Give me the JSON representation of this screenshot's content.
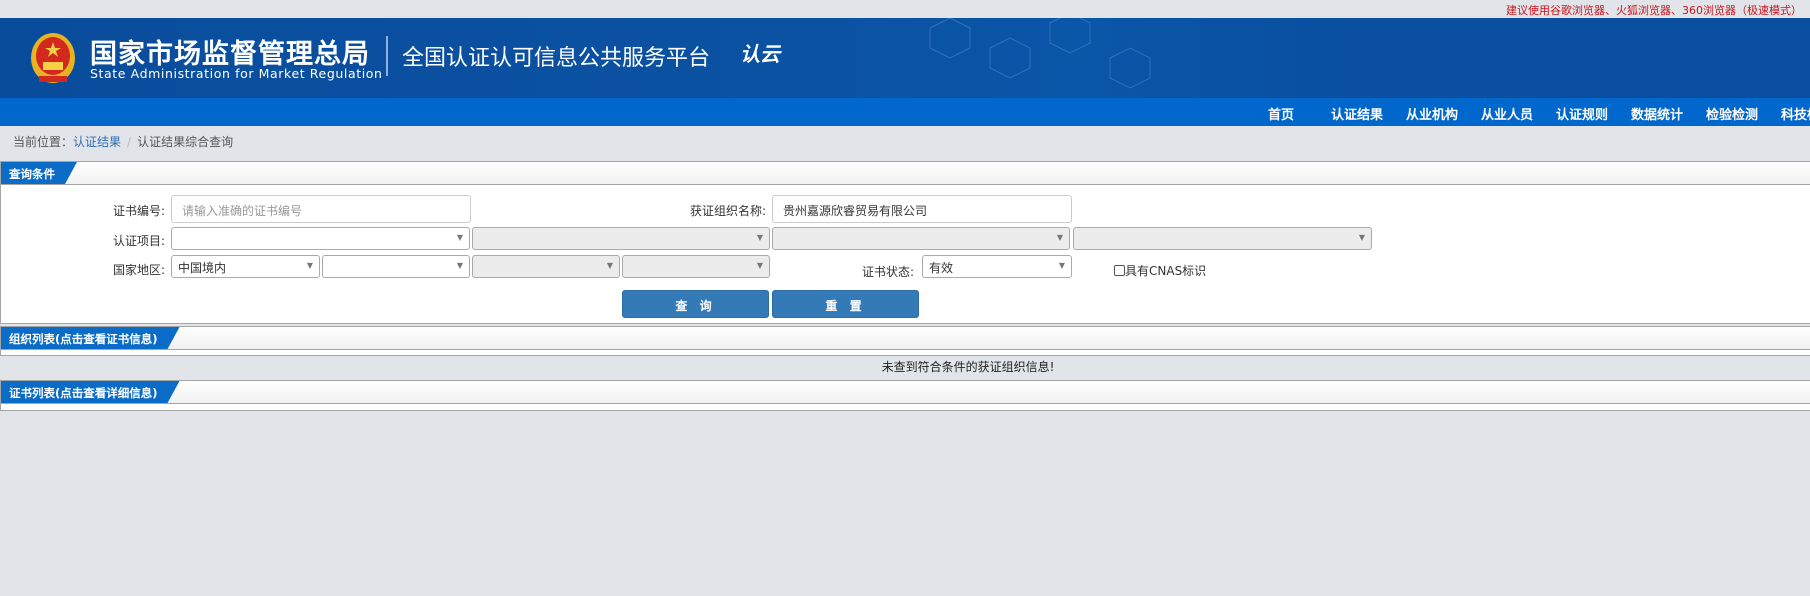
{
  "top_tip": "建议使用谷歌浏览器、火狐浏览器、360浏览器（极速模式）",
  "header": {
    "org_cn": "国家市场监督管理总局",
    "org_en": "State Administration  for  Market Regulation",
    "platform": "全国认证认可信息公共服务平台",
    "logo_text": "认云"
  },
  "nav": [
    "首页",
    "认证结果",
    "从业机构",
    "从业人员",
    "认证规则",
    "数据统计",
    "检验检测",
    "科技标"
  ],
  "breadcrumb": {
    "prefix": "当前位置：",
    "link": "认证结果",
    "current": "认证结果综合查询"
  },
  "query_panel": {
    "title": "查询条件",
    "cert_no_label": "证书编号:",
    "cert_no_placeholder": "请输入准确的证书编号",
    "org_name_label": "获证组织名称:",
    "org_name_value": "贵州嘉源欣睿贸易有限公司",
    "project_label": "认证项目:",
    "region_label": "国家地区:",
    "region_value": "中国境内",
    "status_label": "证书状态:",
    "status_value": "有效",
    "cnas_label": "具有CNAS标识",
    "query_button": "查 询",
    "reset_button": "重 置"
  },
  "org_list": {
    "title": "组织列表(点击查看证书信息)",
    "empty_message": "未查到符合条件的获证组织信息!"
  },
  "cert_list": {
    "title": "证书列表(点击查看详细信息)"
  }
}
